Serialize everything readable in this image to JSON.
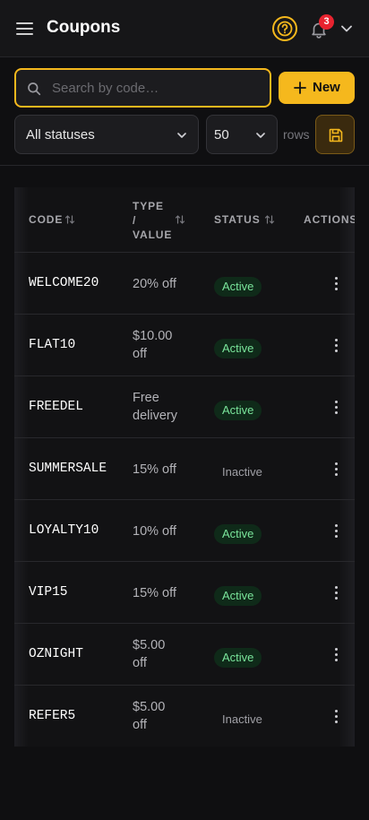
{
  "header": {
    "title": "Coupons",
    "help_icon": "question-circle-icon",
    "notifications_count": "3"
  },
  "toolbar": {
    "search_placeholder": "Search by code…",
    "search_value": "",
    "new_label": "New",
    "status_filter": "All statuses",
    "rows_per_page": "50",
    "rows_label": "rows"
  },
  "table": {
    "columns": [
      "CODE",
      "TYPE / VALUE",
      "STATUS",
      "ACTIONS"
    ],
    "rows": [
      {
        "code": "WELCOME20",
        "value_lines": [
          "20% off"
        ],
        "status": "Active"
      },
      {
        "code": "FLAT10",
        "value_lines": [
          "$10.00",
          "off"
        ],
        "status": "Active"
      },
      {
        "code": "FREEDEL",
        "value_lines": [
          "Free",
          "delivery"
        ],
        "status": "Active"
      },
      {
        "code": "SUMMERSALE",
        "value_lines": [
          "15% off"
        ],
        "status": "Inactive"
      },
      {
        "code": "LOYALTY10",
        "value_lines": [
          "10% off"
        ],
        "status": "Active"
      },
      {
        "code": "VIP15",
        "value_lines": [
          "15% off"
        ],
        "status": "Active"
      },
      {
        "code": "OZNIGHT",
        "value_lines": [
          "$5.00",
          "off"
        ],
        "status": "Active"
      },
      {
        "code": "REFER5",
        "value_lines": [
          "$5.00",
          "off"
        ],
        "status": "Inactive"
      }
    ]
  },
  "colors": {
    "accent": "#f5b81d",
    "active_text": "#7ae59b",
    "badge": "#e8232f"
  }
}
